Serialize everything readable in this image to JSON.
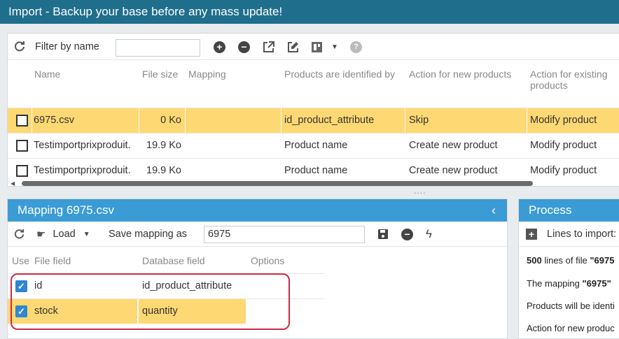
{
  "title": "Import - Backup your base before any mass update!",
  "toolbar": {
    "filter_label": "Filter by name",
    "filter_value": "",
    "icons": [
      "refresh-icon",
      "add-icon",
      "remove-icon",
      "external-link-icon",
      "edit-icon",
      "columns-icon",
      "caret-down-icon",
      "help-icon"
    ]
  },
  "table": {
    "headers": {
      "name": "Name",
      "size": "File size",
      "mapping": "Mapping",
      "identified": "Products are identified by",
      "new": "Action for new products",
      "existing": "Action for existing products"
    },
    "rows": [
      {
        "name": "6975.csv",
        "size": "0 Ko",
        "mapping": "",
        "identified": "id_product_attribute",
        "new": "Skip",
        "existing": "Modify product",
        "selected": true
      },
      {
        "name": "Testimportprixproduit.",
        "size": "19.9 Ko",
        "mapping": "",
        "identified": "Product name",
        "new": "Create new product",
        "existing": "Modify product",
        "selected": false
      },
      {
        "name": "Testimportprixproduit.",
        "size": "19.9 Ko",
        "mapping": "",
        "identified": "Product name",
        "new": "Create new product",
        "existing": "Modify product",
        "selected": false
      }
    ]
  },
  "splitter": "....",
  "mapping": {
    "title": "Mapping 6975.csv",
    "load_label": "Load",
    "save_label": "Save mapping as",
    "save_value": "6975",
    "headers": {
      "use": "Use",
      "file": "File field",
      "db": "Database field",
      "options": "Options"
    },
    "rows": [
      {
        "file": "id",
        "db": "id_product_attribute",
        "checked": true,
        "selected": false
      },
      {
        "file": "stock",
        "db": "quantity",
        "checked": true,
        "selected": true
      }
    ]
  },
  "process": {
    "title": "Process",
    "lines_label": "Lines to import:",
    "line1_bold": "500",
    "line1_rest": " lines of file ",
    "line1_file": "\"6975",
    "line2_start": "The mapping ",
    "line2_bold": "\"6975\"",
    "line3": "Products will be identi",
    "line4": "Action for new produc"
  },
  "colors": {
    "title_bar": "#1f6e8c",
    "panel_head": "#3a9bd5",
    "selected": "#fed873",
    "highlight_outline": "#cc2a45",
    "checkbox": "#2f86d4"
  }
}
